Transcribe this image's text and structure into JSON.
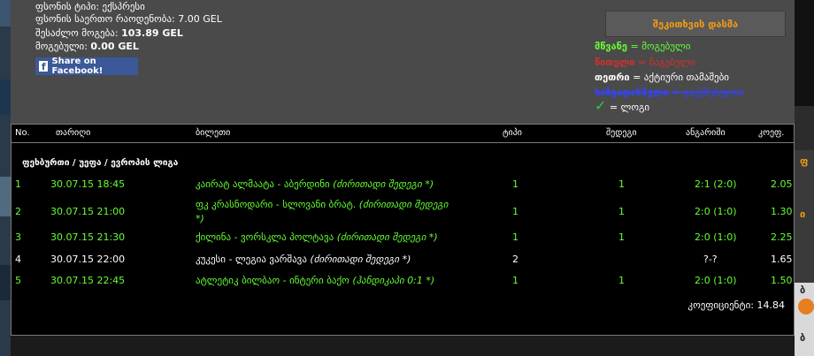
{
  "ticket_info": {
    "type_label": "ფსონის ტიპი: ექსპრესი",
    "amount_label": "ფსონის საერთო რაოდენობა: 7.00 GEL",
    "possible_label": "შესაძლო მოგება:",
    "possible_value": "103.89 GEL",
    "won_label": "მოგებული:",
    "won_value": "0.00 GEL"
  },
  "facebook": {
    "label": "Share on Facebook!",
    "icon": "f"
  },
  "download_button": {
    "label": "შეკითხვის დასმა"
  },
  "legend": {
    "green_word": "მწვანე",
    "green_text": "მოგებული",
    "red_word": "წითელი",
    "red_text": "წაგებული",
    "white_word": "თეთრი",
    "white_text": "აქტიური თამაშები",
    "blue_word": "ხაზგადასმული",
    "blue_text": "გაუქმებულია",
    "check_text": "ლოგი",
    "check_icon": "✓"
  },
  "table": {
    "headers": {
      "no": "No.",
      "date": "თარიღი",
      "event": "ბილეთი",
      "type": "ტიპი",
      "result": "შედეგი",
      "score": "ანგარიში",
      "coef": "კოეფ."
    },
    "group": "ფეხბურთი / უეფა / ევროპის ლიგა",
    "rows": [
      {
        "no": "1",
        "date": "30.07.15 18:45",
        "event": "კაირატ ალმაატა - აბერდინი",
        "note": "(ძირითადი შედეგი *)",
        "event2": "",
        "type": "1",
        "result": "1",
        "score": "2:1 (2:0)",
        "coef": "2.05"
      },
      {
        "no": "2",
        "date": "30.07.15 21:00",
        "event": "ფკ კრასნოდარი - სლოვანი ბრატ.",
        "note": "(ძირითადი შედეგი",
        "event2": "*)",
        "type": "1",
        "result": "1",
        "score": "2:0 (1:0)",
        "coef": "1.30"
      },
      {
        "no": "3",
        "date": "30.07.15 21:30",
        "event": "ქილინა - ვორსკლა პოლტავა",
        "note": "(ძირითადი შედეგი *)",
        "event2": "",
        "type": "1",
        "result": "1",
        "score": "2:0 (1:0)",
        "coef": "2.25"
      },
      {
        "no": "4",
        "date": "30.07.15 22:00",
        "event": "კუკესი - ლეგია ვარშავა",
        "note": "(ძირითადი შედეგი *)",
        "event2": "",
        "type": "2",
        "result": "",
        "score": "?-?",
        "coef": "1.65"
      },
      {
        "no": "5",
        "date": "30.07.15 22:45",
        "event": "ატლეტიკ ბილბაო - ინტერი ბაქო",
        "note": "(ჰანდიკაპი 0:1 *)",
        "event2": "",
        "type": "1",
        "result": "1",
        "score": "2:0 (1:0)",
        "coef": "1.50"
      }
    ],
    "total": "კოეფიციენტი: 14.84"
  },
  "side": {
    "r1": "ფ",
    "r2": "ი",
    "r3": "ბ",
    "r4": "ბ"
  },
  "colors": {
    "green": "#66ff33",
    "orange": "#f39c12",
    "red": "#d32f2f",
    "blue": "#3344ff",
    "facebook": "#3b5998"
  }
}
